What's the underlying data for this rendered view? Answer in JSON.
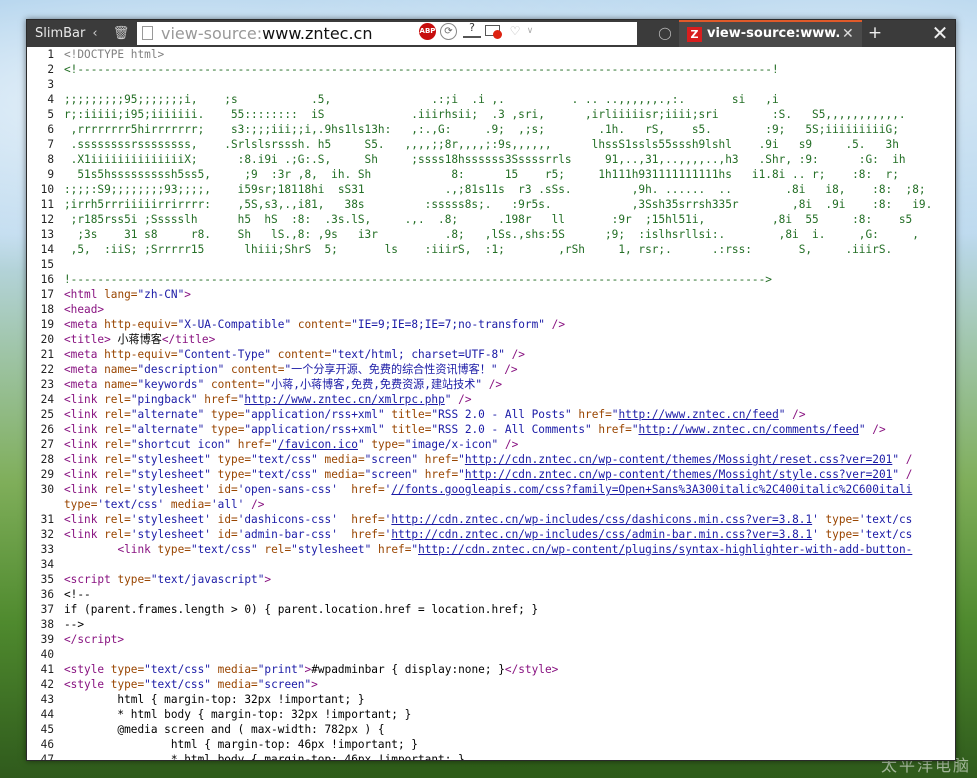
{
  "browser": {
    "sidebar_label": "SlimBar",
    "url_scheme": "view-source:",
    "url_host": "www.zntec.cn",
    "ext_abp": "ABP",
    "ext_q": "?",
    "tab_title": "view-source:www.znt...",
    "tab_favicon": "Z",
    "icons": [
      "back-chevron-icon",
      "trash-icon",
      "page-icon",
      "adblock-icon",
      "sync-icon",
      "help-icon",
      "block-icon",
      "heart-icon",
      "chevron-down-icon",
      "tab-icon",
      "tab-close-icon",
      "new-tab-icon",
      "window-close-icon"
    ]
  },
  "source": {
    "lines": [
      {
        "n": "1",
        "html": "<span class=\"dt\">&lt;!DOCTYPE html&gt;</span>"
      },
      {
        "n": "2",
        "html": "<span class=\"cm\">&lt;!--------------------------------------------------------------------------------------------------------!</span>"
      },
      {
        "n": "3",
        "html": ""
      },
      {
        "n": "4",
        "html": "<span class=\"cm\">;;;;;;;;;95;;;;;;;i,    ;s           .5,               .:;i  .i ,.          . .. ..,,,,,,.,:.       si   ,i</span>"
      },
      {
        "n": "5",
        "html": "<span class=\"cm\">r;:iiiii;i95;iiiiiii.    55::::::::  iS             .iiirhsii;  .3 ,sri,      ,irliiiiisr;iiii;sri        :S.   S5,,,,,,,,,,,.</span>"
      },
      {
        "n": "6",
        "html": "<span class=\"cm\"> ,rrrrrrrr5hirrrrrrr;    s3:;;;iii;;i,.9hs1ls13h:   ,:.,G:     .9;  ,;s;        .1h.   rS,    s5.        :9;   5S;iiiiiiiiiG;</span>"
      },
      {
        "n": "7",
        "html": "<span class=\"cm\"> .ssssssssrssssssss,    .Srlslsrsssh. h5     S5.   ,,,,;;8r,,,,;:9s,,,,,,      lhssS1ssls55sssh9lshl    .9i   s9     .5.   3h</span>"
      },
      {
        "n": "8",
        "html": "<span class=\"cm\"> .X1iiiiiiiiiiiiiiX;      :8.i9i .;G:.S,     Sh     ;ssss18hssssss3Sssssrrls     91,..,31,..,,,,..,h3   .Shr, :9:      :G:  ih</span>"
      },
      {
        "n": "9",
        "html": "<span class=\"cm\">  51s5hsssssssssh5ss5,     ;9  :3r ,8,  ih. Sh            8:      15    r5;     1h111h931111111111hs   i1.8i .. r;    :8:  r;</span>"
      },
      {
        "n": "10",
        "html": "<span class=\"cm\">:;;;:S9;;;;;;;;93;;;;,    i59sr;18118hi  sS31            .,;81s11s  r3 .sSs.         ,9h. ......  ..        .8i   i8,    :8:  ;8;</span>"
      },
      {
        "n": "11",
        "html": "<span class=\"cm\">;irrh5rrriiiiirrirrrr:    ,5S,s3,.,i81,   38s         :sssss8s;.   :9r5s.            ,3Ssh35srrsh335r        ,8i  .9i    :8:   i9.</span>"
      },
      {
        "n": "12",
        "html": "<span class=\"cm\"> ;r185rss5i ;Ssssslh      h5  hS  :8:  .3s.lS,     .,.  .8;      .198r   ll       :9r  ;15hl51i,          ,8i  55     :8:    s5</span>"
      },
      {
        "n": "13",
        "html": "<span class=\"cm\">  ;3s    31 s8     r8.    Sh   lS.,8: ,9s   i3r          .8;   ,lSs.,shs:5S      ;9;  :islhsrllsi:.        ,8i  i.     ,G:     ,</span>"
      },
      {
        "n": "14",
        "html": "<span class=\"cm\"> ,5,  :iiS; ;Srrrrr15      lhiii;ShrS  5;       ls    :iiirS,  :1;        ,rSh     1, rsr;.      .:rss:       S,     .iiirS.</span>"
      },
      {
        "n": "15",
        "html": ""
      },
      {
        "n": "16",
        "html": "<span class=\"cm\">!--------------------------------------------------------------------------------------------------------&gt;</span>"
      },
      {
        "n": "17",
        "html": "<span class=\"t\">&lt;html</span> <span class=\"a\">lang=</span><span class=\"v\">\"zh-CN\"</span><span class=\"t\">&gt;</span>"
      },
      {
        "n": "18",
        "html": "<span class=\"t\">&lt;head&gt;</span>"
      },
      {
        "n": "19",
        "html": "<span class=\"t\">&lt;meta</span> <span class=\"a\">http-equiv=</span><span class=\"v\">\"X-UA-Compatible\"</span> <span class=\"a\">content=</span><span class=\"v\">\"IE=9;IE=8;IE=7;no-transform\"</span> <span class=\"t\">/&gt;</span>"
      },
      {
        "n": "20",
        "html": "<span class=\"t\">&lt;title&gt;</span> 小蒋博客<span class=\"t\">&lt;/title&gt;</span>"
      },
      {
        "n": "21",
        "html": "<span class=\"t\">&lt;meta</span> <span class=\"a\">http-equiv=</span><span class=\"v\">\"Content-Type\"</span> <span class=\"a\">content=</span><span class=\"v\">\"text/html; charset=UTF-8\"</span> <span class=\"t\">/&gt;</span>"
      },
      {
        "n": "22",
        "html": "<span class=\"t\">&lt;meta</span> <span class=\"a\">name=</span><span class=\"v\">\"description\"</span> <span class=\"a\">content=</span><span class=\"v\">\"一个分享开源、免费的综合性资讯博客！\"</span> <span class=\"t\">/&gt;</span>"
      },
      {
        "n": "23",
        "html": "<span class=\"t\">&lt;meta</span> <span class=\"a\">name=</span><span class=\"v\">\"keywords\"</span> <span class=\"a\">content=</span><span class=\"v\">\"小蒋,小蒋博客,免费,免费资源,建站技术\"</span> <span class=\"t\">/&gt;</span>"
      },
      {
        "n": "24",
        "html": "<span class=\"t\">&lt;link</span> <span class=\"a\">rel=</span><span class=\"v\">\"pingback\"</span> <span class=\"a\">href=</span><span class=\"v\">\"</span><span class=\"l\">http://www.zntec.cn/xmlrpc.php</span><span class=\"v\">\"</span> <span class=\"t\">/&gt;</span>"
      },
      {
        "n": "25",
        "html": "<span class=\"t\">&lt;link</span> <span class=\"a\">rel=</span><span class=\"v\">\"alternate\"</span> <span class=\"a\">type=</span><span class=\"v\">\"application/rss+xml\"</span> <span class=\"a\">title=</span><span class=\"v\">\"RSS 2.0 - All Posts\"</span> <span class=\"a\">href=</span><span class=\"v\">\"</span><span class=\"l\">http://www.zntec.cn/feed</span><span class=\"v\">\"</span> <span class=\"t\">/&gt;</span>"
      },
      {
        "n": "26",
        "html": "<span class=\"t\">&lt;link</span> <span class=\"a\">rel=</span><span class=\"v\">\"alternate\"</span> <span class=\"a\">type=</span><span class=\"v\">\"application/rss+xml\"</span> <span class=\"a\">title=</span><span class=\"v\">\"RSS 2.0 - All Comments\"</span> <span class=\"a\">href=</span><span class=\"v\">\"</span><span class=\"l\">http://www.zntec.cn/comments/feed</span><span class=\"v\">\"</span> <span class=\"t\">/&gt;</span>"
      },
      {
        "n": "27",
        "html": "<span class=\"t\">&lt;link</span> <span class=\"a\">rel=</span><span class=\"v\">\"shortcut icon\"</span> <span class=\"a\">href=</span><span class=\"v\">\"</span><span class=\"l\">/favicon.ico</span><span class=\"v\">\"</span> <span class=\"a\">type=</span><span class=\"v\">\"image/x-icon\"</span> <span class=\"t\">/&gt;</span>"
      },
      {
        "n": "28",
        "html": "<span class=\"t\">&lt;link</span> <span class=\"a\">rel=</span><span class=\"v\">\"stylesheet\"</span> <span class=\"a\">type=</span><span class=\"v\">\"text/css\"</span> <span class=\"a\">media=</span><span class=\"v\">\"screen\"</span> <span class=\"a\">href=</span><span class=\"v\">\"</span><span class=\"l\">http://cdn.zntec.cn/wp-content/themes/Mossight/reset.css?ver=201</span><span class=\"v\">\"</span> <span class=\"t\">/</span>"
      },
      {
        "n": "29",
        "html": "<span class=\"t\">&lt;link</span> <span class=\"a\">rel=</span><span class=\"v\">\"stylesheet\"</span> <span class=\"a\">type=</span><span class=\"v\">\"text/css\"</span> <span class=\"a\">media=</span><span class=\"v\">\"screen\"</span> <span class=\"a\">href=</span><span class=\"v\">\"</span><span class=\"l\">http://cdn.zntec.cn/wp-content/themes/Mossight/style.css?ver=201</span><span class=\"v\">\"</span> <span class=\"t\">/</span>"
      },
      {
        "n": "30",
        "html": "<span class=\"t\">&lt;link</span> <span class=\"a\">rel=</span><span class=\"v\">'stylesheet'</span> <span class=\"a\">id=</span><span class=\"v\">'open-sans-css'</span>  <span class=\"a\">href=</span><span class=\"v\">'</span><span class=\"l\">//fonts.googleapis.com/css?family=Open+Sans%3A300italic%2C400italic%2C600itali</span>"
      },
      {
        "n": "",
        "html": "<span class=\"a\">type=</span><span class=\"v\">'text/css'</span> <span class=\"a\">media=</span><span class=\"v\">'all'</span> <span class=\"t\">/&gt;</span>"
      },
      {
        "n": "31",
        "html": "<span class=\"t\">&lt;link</span> <span class=\"a\">rel=</span><span class=\"v\">'stylesheet'</span> <span class=\"a\">id=</span><span class=\"v\">'dashicons-css'</span>  <span class=\"a\">href=</span><span class=\"v\">'</span><span class=\"l\">http://cdn.zntec.cn/wp-includes/css/dashicons.min.css?ver=3.8.1</span><span class=\"v\">'</span> <span class=\"a\">type=</span><span class=\"v\">'text/cs</span>"
      },
      {
        "n": "32",
        "html": "<span class=\"t\">&lt;link</span> <span class=\"a\">rel=</span><span class=\"v\">'stylesheet'</span> <span class=\"a\">id=</span><span class=\"v\">'admin-bar-css'</span>  <span class=\"a\">href=</span><span class=\"v\">'</span><span class=\"l\">http://cdn.zntec.cn/wp-includes/css/admin-bar.min.css?ver=3.8.1</span><span class=\"v\">'</span> <span class=\"a\">type=</span><span class=\"v\">'text/cs</span>"
      },
      {
        "n": "33",
        "html": "        <span class=\"t\">&lt;link</span> <span class=\"a\">type=</span><span class=\"v\">\"text/css\"</span> <span class=\"a\">rel=</span><span class=\"v\">\"stylesheet\"</span> <span class=\"a\">href=</span><span class=\"v\">\"</span><span class=\"l\">http://cdn.zntec.cn/wp-content/plugins/syntax-highlighter-with-add-button-</span>"
      },
      {
        "n": "34",
        "html": ""
      },
      {
        "n": "35",
        "html": "<span class=\"t\">&lt;script</span> <span class=\"a\">type=</span><span class=\"v\">\"text/javascript\"</span><span class=\"t\">&gt;</span>"
      },
      {
        "n": "36",
        "html": "&lt;!--"
      },
      {
        "n": "37",
        "html": "if (parent.frames.length &gt; 0) { parent.location.href = location.href; }"
      },
      {
        "n": "38",
        "html": "--&gt;"
      },
      {
        "n": "39",
        "html": "<span class=\"t\">&lt;/script&gt;</span>"
      },
      {
        "n": "40",
        "html": ""
      },
      {
        "n": "41",
        "html": "<span class=\"t\">&lt;style</span> <span class=\"a\">type=</span><span class=\"v\">\"text/css\"</span> <span class=\"a\">media=</span><span class=\"v\">\"print\"</span><span class=\"t\">&gt;</span>#wpadminbar { display:none; }<span class=\"t\">&lt;/style&gt;</span>"
      },
      {
        "n": "42",
        "html": "<span class=\"t\">&lt;style</span> <span class=\"a\">type=</span><span class=\"v\">\"text/css\"</span> <span class=\"a\">media=</span><span class=\"v\">\"screen\"</span><span class=\"t\">&gt;</span>"
      },
      {
        "n": "43",
        "html": "        html { margin-top: 32px !important; }"
      },
      {
        "n": "44",
        "html": "        * html body { margin-top: 32px !important; }"
      },
      {
        "n": "45",
        "html": "        @media screen and ( max-width: 782px ) {"
      },
      {
        "n": "46",
        "html": "                html { margin-top: 46px !important; }"
      },
      {
        "n": "47",
        "html": "                * html body { margin-top: 46px !important; }"
      }
    ]
  },
  "desktop": {
    "watermark": "太平洋电脑"
  }
}
